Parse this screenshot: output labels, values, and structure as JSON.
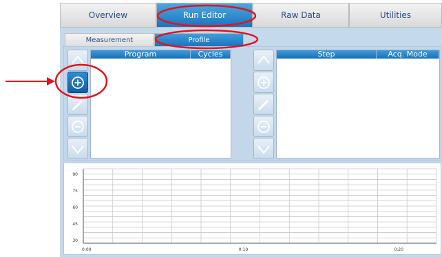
{
  "top_tabs": [
    {
      "label": "Overview",
      "active": false
    },
    {
      "label": "Run Editor",
      "active": true
    },
    {
      "label": "Raw Data",
      "active": false
    },
    {
      "label": "Utilities",
      "active": false
    }
  ],
  "sub_tabs": [
    {
      "label": "Measurement",
      "active": false
    },
    {
      "label": "Profile",
      "active": true
    }
  ],
  "program_table": {
    "columns": [
      "Program",
      "Cycles"
    ]
  },
  "step_table": {
    "columns": [
      "Step",
      "Acq. Mode"
    ]
  },
  "side_buttons": [
    "move-up",
    "add",
    "edit",
    "remove",
    "move-down"
  ],
  "chart_data": {
    "type": "line",
    "y_ticks": [
      "90",
      "75",
      "60",
      "45",
      "30"
    ],
    "x_ticks": [
      "0:00",
      "0:10",
      "0:20"
    ],
    "ylim": [
      30,
      90
    ],
    "grid": true,
    "series": []
  },
  "colors": {
    "accent": "#1c74bd",
    "panel": "#c4d7ea",
    "annotation": "#e0141e"
  }
}
